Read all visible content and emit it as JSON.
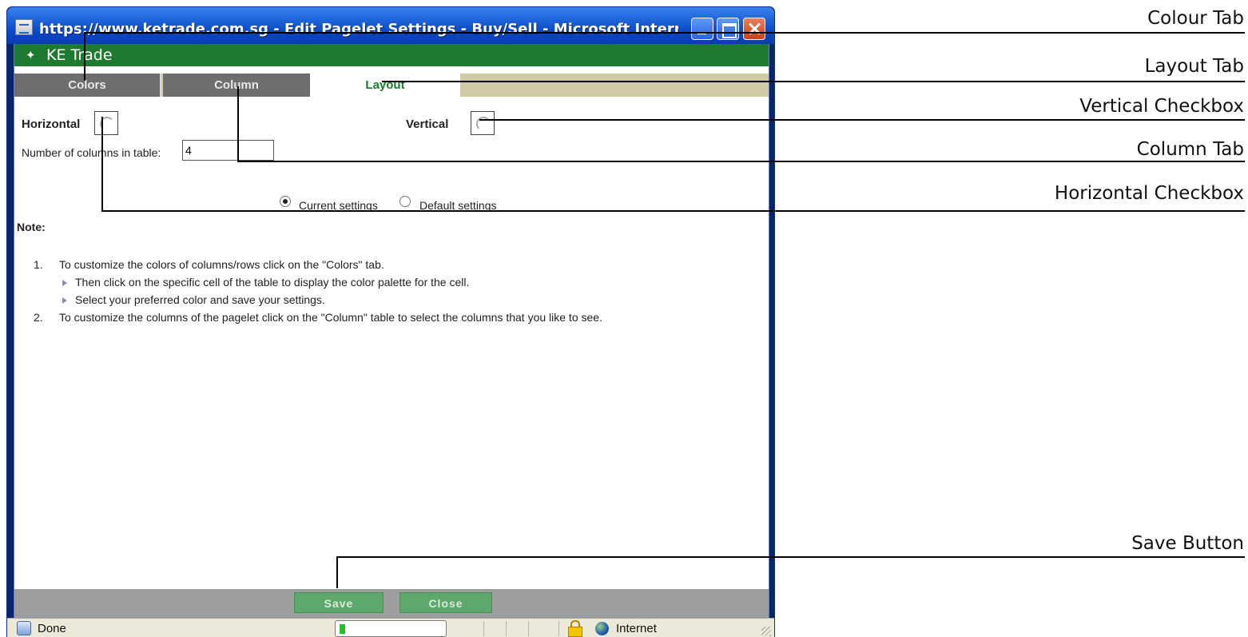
{
  "window": {
    "title": "https://www.ketrade.com.sg - Edit Pagelet Settings - Buy/Sell - Microsoft Internet Ex..."
  },
  "brand": {
    "logo": "✦",
    "name": "KE Trade"
  },
  "tabs": [
    {
      "label": "Colors"
    },
    {
      "label": "Column"
    },
    {
      "label": "Layout",
      "active": true
    }
  ],
  "layout": {
    "horizontal_label": "Horizontal",
    "vertical_label": "Vertical",
    "columns_label": "Number of columns in table:",
    "columns_value": "4",
    "settings": [
      {
        "label": "Current settings",
        "checked": true
      },
      {
        "label": "Default settings",
        "checked": false
      }
    ]
  },
  "note": {
    "heading": "Note:",
    "items": [
      {
        "num": "1.",
        "text": "To customize the colors of columns/rows click on the \"Colors\" tab.",
        "sub": [
          "Then click on the specific cell of the table to display the color palette for the cell.",
          "Select your preferred color and save your settings."
        ]
      },
      {
        "num": "2.",
        "text": "To customize the columns of the pagelet click on the \"Column\" table to select the columns that you like to see."
      }
    ]
  },
  "buttons": {
    "save": "Save",
    "close": "Close"
  },
  "status": {
    "text": "Done",
    "zone": "Internet",
    "progress": 0.05
  },
  "callouts": [
    {
      "label": "Colour Tab"
    },
    {
      "label": "Layout Tab"
    },
    {
      "label": "Vertical Checkbox"
    },
    {
      "label": "Column Tab"
    },
    {
      "label": "Horizontal Checkbox"
    },
    {
      "label": "Save Button"
    }
  ],
  "colors": {
    "brand_green": "#1d7a2e",
    "tab_inactive": "#6e6e6e",
    "button_green": "#5da86a",
    "titlebar_blue": "#0a46c4"
  }
}
